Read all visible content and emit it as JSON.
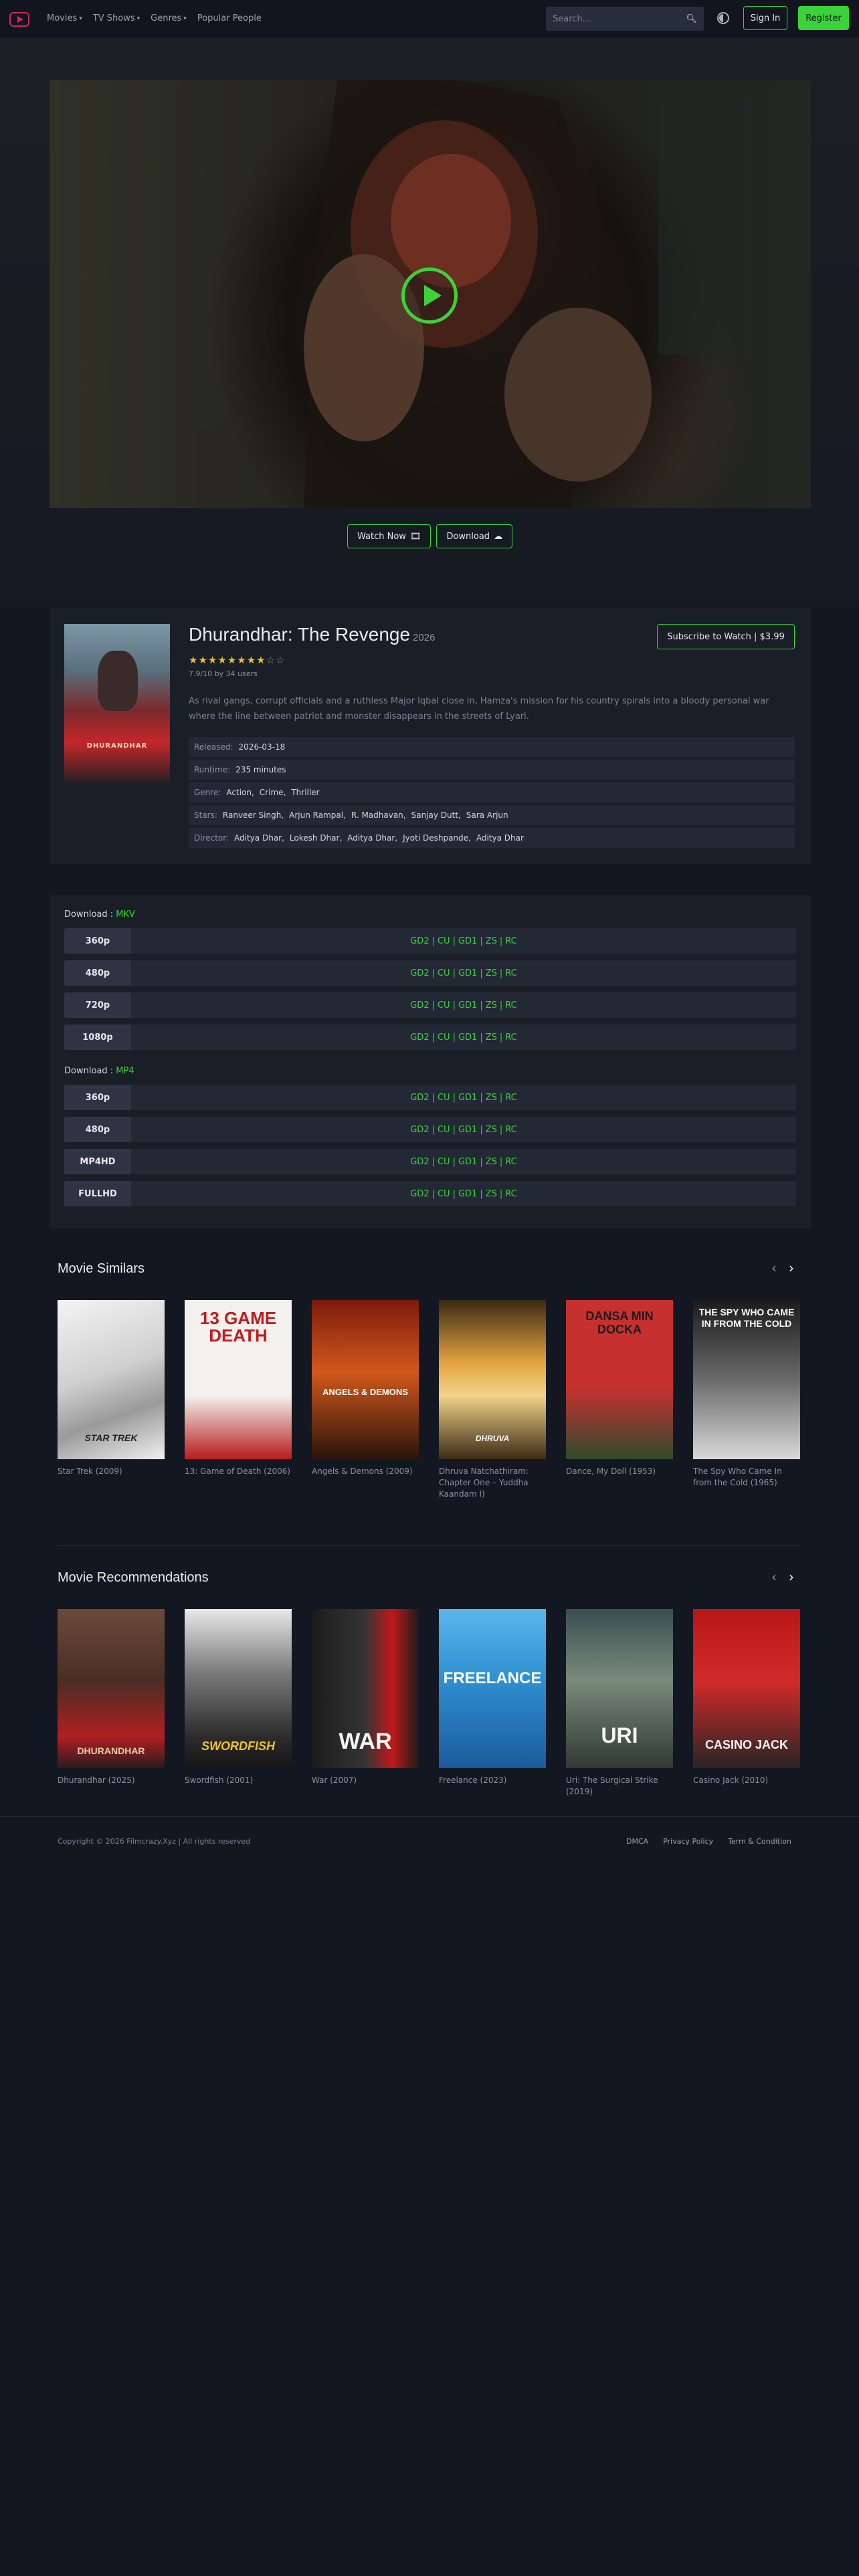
{
  "nav": {
    "items": [
      "Movies",
      "TV Shows",
      "Genres",
      "Popular People"
    ],
    "search_placeholder": "Search...",
    "signin_label": "Sign In",
    "register_label": "Register",
    "icons": {
      "logo": "play-screen-icon",
      "search": "search-icon",
      "theme": "theme-toggle-icon",
      "caret": "chevron-down-icon"
    }
  },
  "hero": {
    "watch_label": "Watch Now",
    "download_label": "Download",
    "icons": {
      "play": "play-icon",
      "watch": "film-icon",
      "download": "cloud-download-icon"
    }
  },
  "movie": {
    "title": "Dhurandhar: The Revenge",
    "year": "2026",
    "poster_text": "DHURANDHAR",
    "rating_stars": 8,
    "rating_max": 10,
    "rating_text": "7.9/10 by 34 users",
    "subscribe_label": "Subscribe to Watch | $3.99",
    "description": "As rival gangs, corrupt officials and a ruthless Major Iqbal close in, Hamza's mission for his country spirals into a bloody personal war where the line between patriot and monster disappears in the streets of Lyari.",
    "info": {
      "released_label": "Released:",
      "released": "2026-03-18",
      "runtime_label": "Runtime:",
      "runtime": "235 minutes",
      "genre_label": "Genre:",
      "genres": [
        "Action,",
        "Crime,",
        "Thriller"
      ],
      "stars_label": "Stars:",
      "stars": [
        "Ranveer Singh,",
        "Arjun Rampal,",
        "R. Madhavan,",
        "Sanjay Dutt,",
        "Sara Arjun"
      ],
      "director_label": "Director:",
      "directors": [
        "Aditya Dhar,",
        "Lokesh Dhar,",
        "Aditya Dhar,",
        "Jyoti Deshpande,",
        "Aditya Dhar"
      ]
    }
  },
  "downloads": {
    "prefix": "Download : ",
    "groups": [
      {
        "format": "MKV",
        "qualities": [
          "360p",
          "480p",
          "720p",
          "1080p"
        ]
      },
      {
        "format": "MP4",
        "qualities": [
          "360p",
          "480p",
          "MP4HD",
          "FULLHD"
        ]
      }
    ],
    "links": [
      "GD2",
      "CU",
      "GD1",
      "ZS",
      "RC"
    ],
    "separator": "|"
  },
  "similars": {
    "title": "Movie Similars",
    "items": [
      {
        "title": "Star Trek (2009)",
        "poster_text": "STAR TREK"
      },
      {
        "title": "13: Game of Death (2006)",
        "poster_text": "13 GAME DEATH"
      },
      {
        "title": "Angels & Demons (2009)",
        "poster_text": "ANGELS & DEMONS"
      },
      {
        "title": "Dhruva Natchathiram: Chapter One – Yuddha Kaandam I)",
        "poster_text": "DHRUVA"
      },
      {
        "title": "Dance, My Doll (1953)",
        "poster_text": "DANSA MIN DOCKA"
      },
      {
        "title": "The Spy Who Came In from the Cold (1965)",
        "poster_text": "THE SPY WHO CAME IN FROM THE COLD"
      }
    ]
  },
  "recommendations": {
    "title": "Movie Recommendations",
    "items": [
      {
        "title": "Dhurandhar (2025)",
        "poster_text": "DHURANDHAR"
      },
      {
        "title": "Swordfish (2001)",
        "poster_text": "SWORDFISH"
      },
      {
        "title": "War (2007)",
        "poster_text": "WAR"
      },
      {
        "title": "Freelance (2023)",
        "poster_text": "FREELANCE"
      },
      {
        "title": "Uri: The Surgical Strike (2019)",
        "poster_text": "URI"
      },
      {
        "title": "Casino Jack (2010)",
        "poster_text": "CASINO JACK"
      }
    ]
  },
  "footer": {
    "copyright": "Copyright © 2026 Filmcrazy.Xyz | All rights reserved",
    "links": [
      "DMCA",
      "Privacy Policy",
      "Term & Condition"
    ]
  },
  "colors": {
    "accent": "#3bd33b",
    "brand": "#d2245d",
    "star": "#e8c21b",
    "background": "#131722",
    "panel": "#1a1e27"
  }
}
